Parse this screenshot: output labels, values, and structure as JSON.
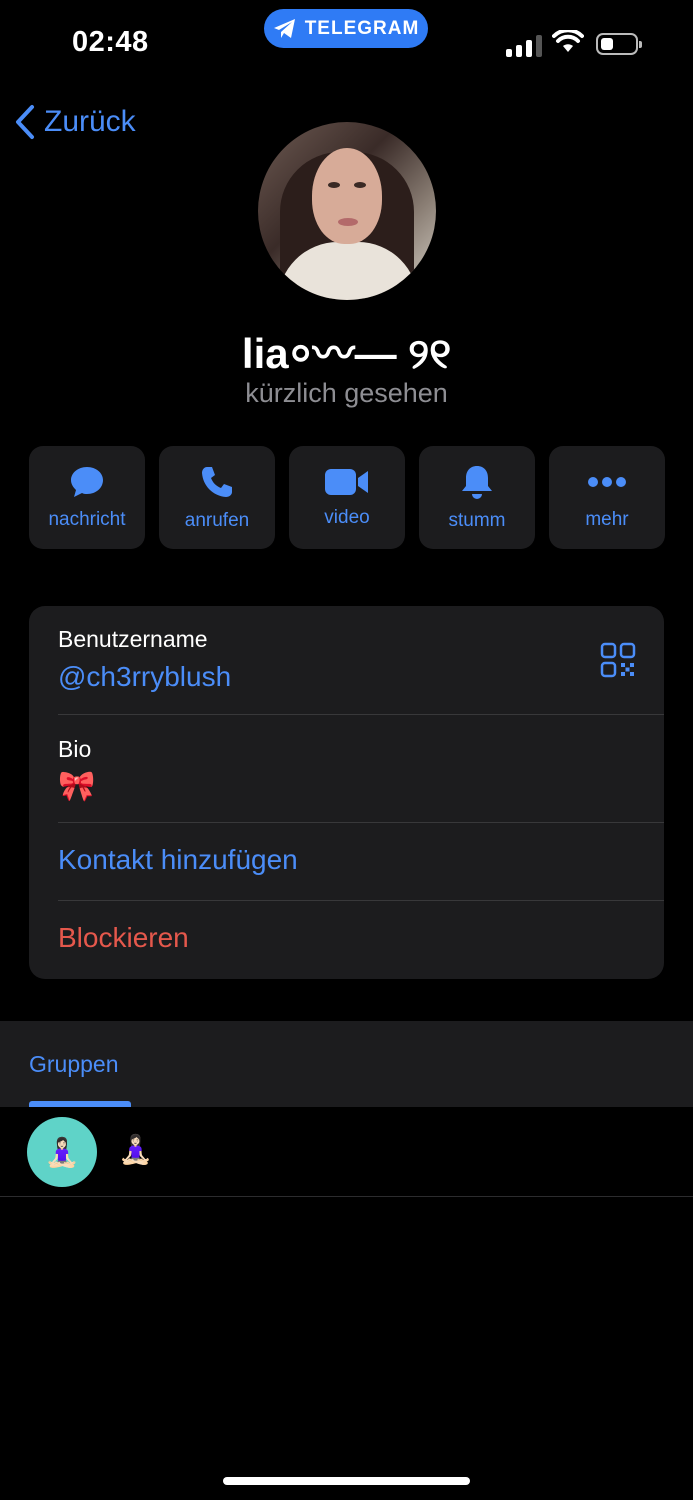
{
  "status_bar": {
    "time": "02:48",
    "app_pill": "TELEGRAM",
    "accent": "#2f7bf5"
  },
  "nav": {
    "back_label": "Zurück"
  },
  "profile": {
    "name": "lia⸰〰— ୨୧",
    "status": "kürzlich gesehen"
  },
  "actions": [
    {
      "label": "nachricht",
      "icon": "chat-bubble-icon"
    },
    {
      "label": "anrufen",
      "icon": "phone-icon"
    },
    {
      "label": "video",
      "icon": "video-camera-icon"
    },
    {
      "label": "stumm",
      "icon": "bell-icon"
    },
    {
      "label": "mehr",
      "icon": "more-dots-icon"
    }
  ],
  "info": {
    "username_label": "Benutzername",
    "username_value": "@ch3rryblush",
    "bio_label": "Bio",
    "bio_value": "🎀",
    "add_contact": "Kontakt hinzufügen",
    "block": "Blockieren"
  },
  "groups": {
    "tab_label": "Gruppen",
    "items": [
      {
        "avatar": "🧘🏻‍♀️",
        "name": "🧘🏻‍♀️"
      }
    ]
  },
  "colors": {
    "link": "#4b8df8",
    "destructive": "#e5584c",
    "card": "#1c1c1e"
  }
}
